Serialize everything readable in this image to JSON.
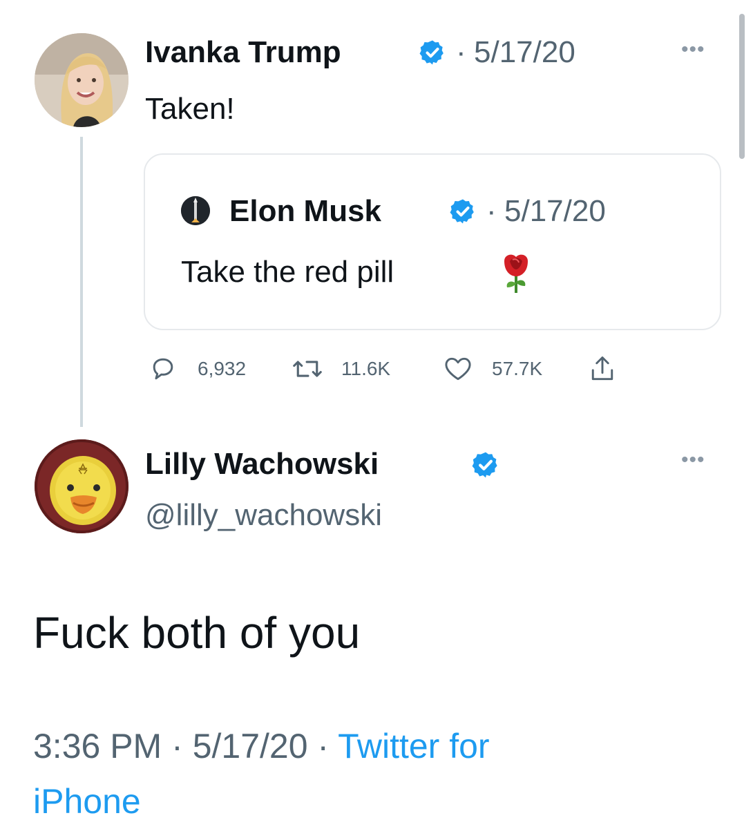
{
  "thread": {
    "parent": {
      "author_name": "Ivanka Trump",
      "date": "5/17/20",
      "separator": "·",
      "text": "Taken!",
      "more_icon": "more-dots-icon",
      "verified_icon": "verified-badge-icon"
    },
    "quoted": {
      "author_name": "Elon Musk",
      "date": "5/17/20",
      "separator": "·",
      "text": "Take the red pill",
      "emoji": "🌹",
      "verified_icon": "verified-badge-icon"
    },
    "actions": {
      "replies": "6,932",
      "retweets": "11.6K",
      "likes": "57.7K",
      "reply_icon": "reply-icon",
      "retweet_icon": "retweet-icon",
      "like_icon": "heart-icon",
      "share_icon": "share-icon"
    },
    "reply": {
      "author_name": "Lilly Wachowski",
      "handle": "@lilly_wachowski",
      "text": "Fuck both of you",
      "time": "3:36 PM",
      "date": "5/17/20",
      "separator": "·",
      "source_line1": "Twitter for",
      "source_line2": "iPhone",
      "more_icon": "more-dots-icon",
      "verified_icon": "verified-badge-icon"
    }
  },
  "colors": {
    "verified_blue": "#1d9bf0",
    "link_blue": "#1d9bf0",
    "text": "#0f1419",
    "secondary": "#536471",
    "border": "#e6e9ec"
  }
}
